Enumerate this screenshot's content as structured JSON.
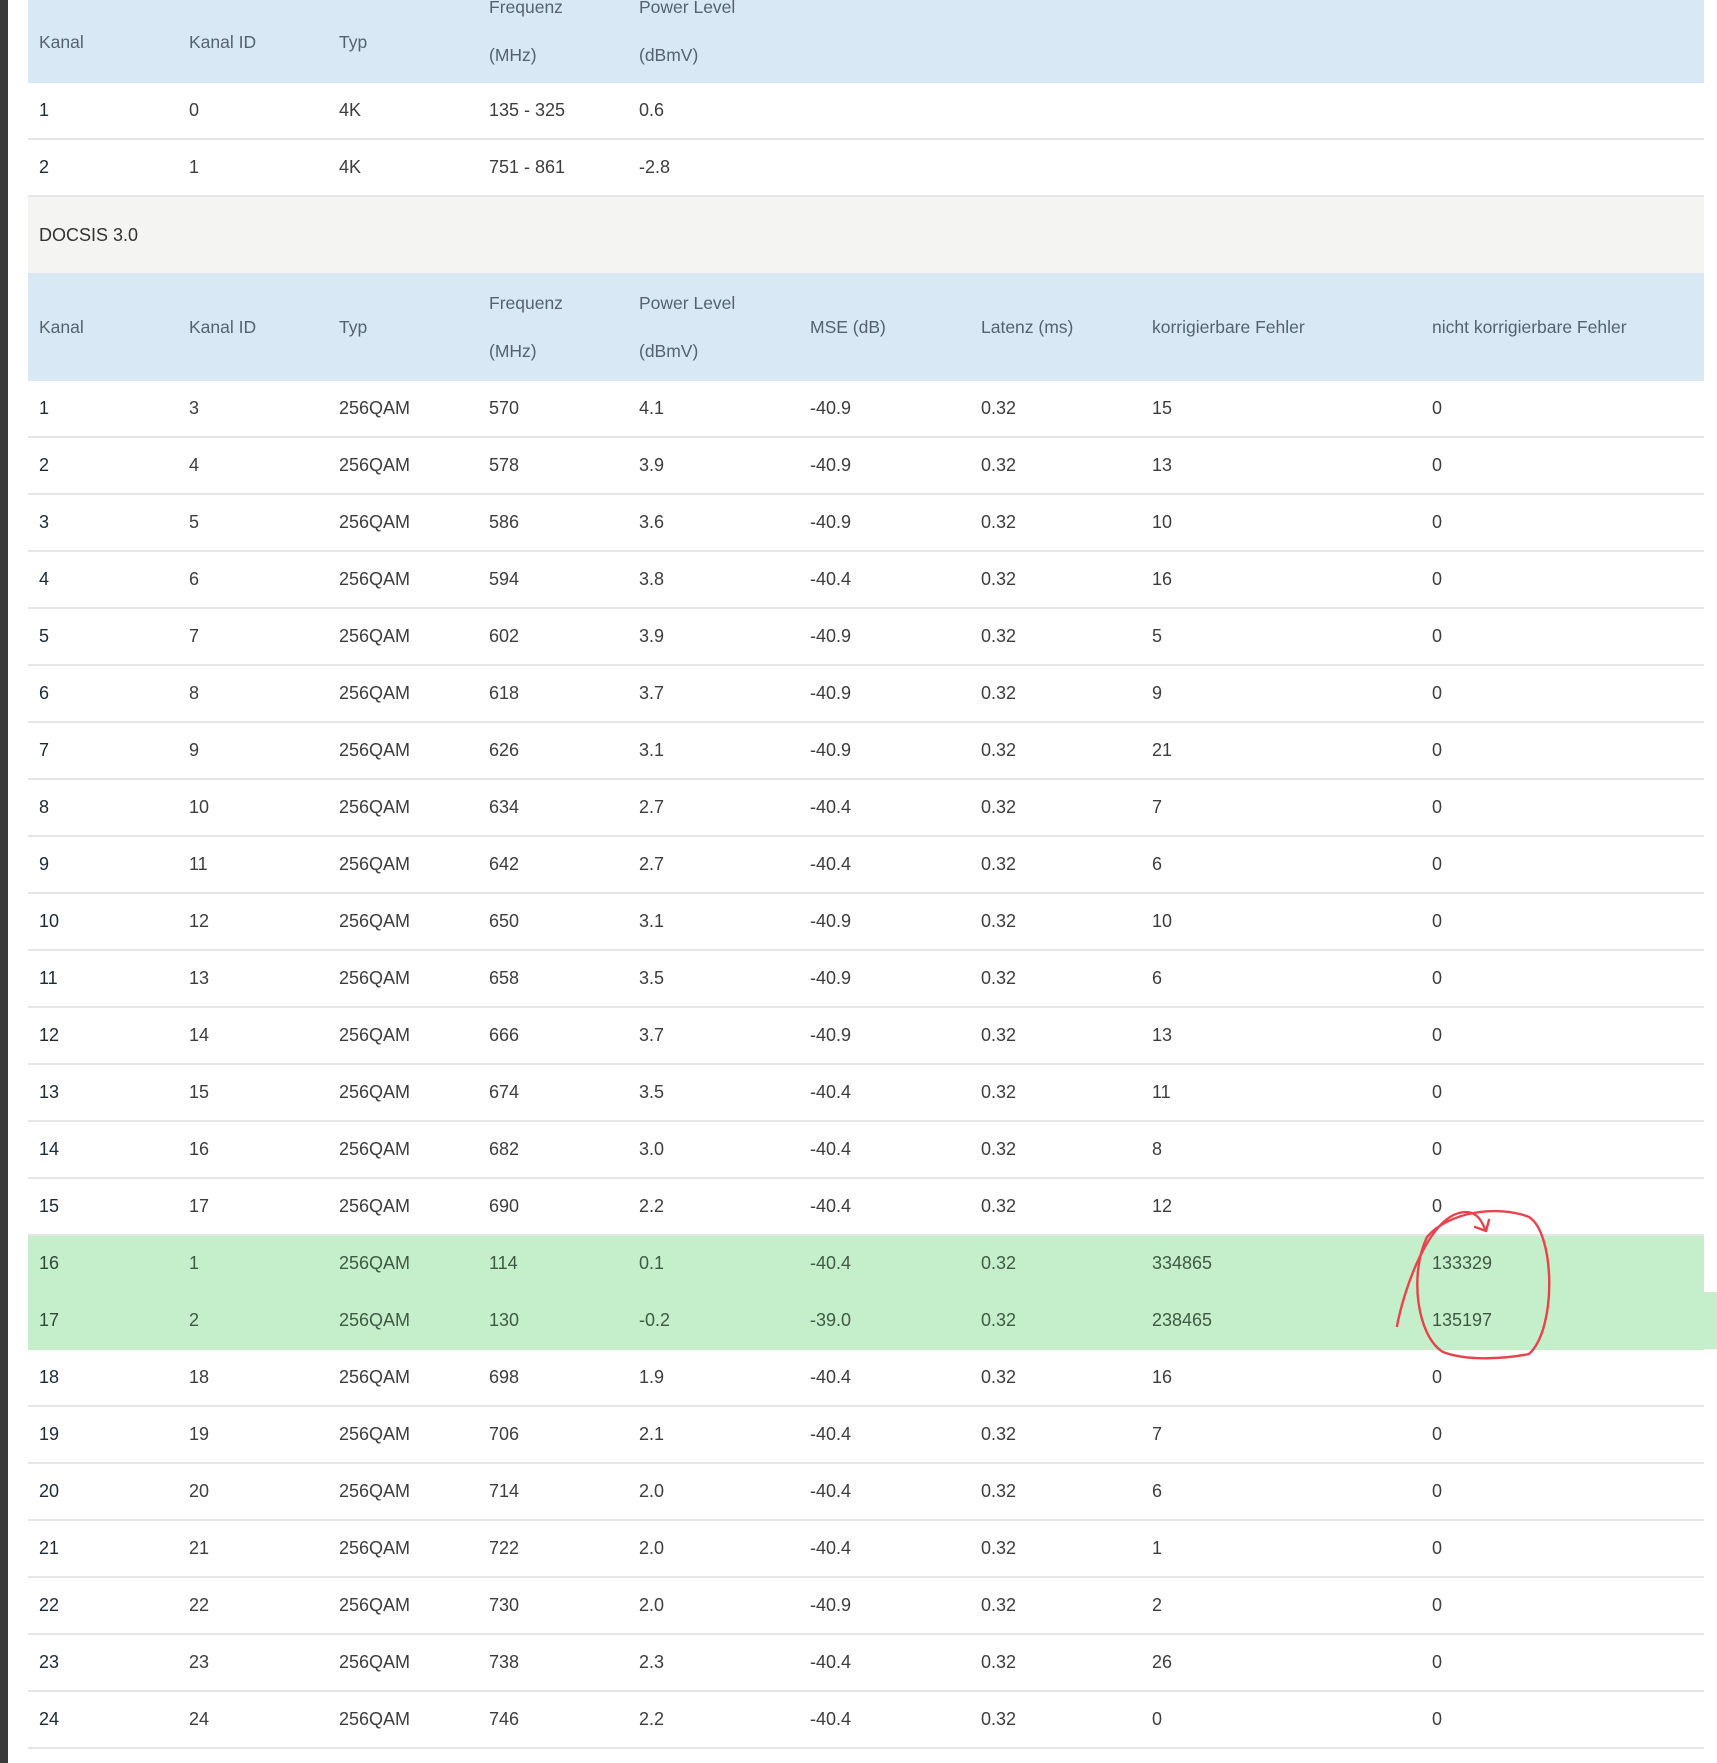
{
  "upstream_table": {
    "headers": {
      "kanal": "Kanal",
      "kanal_id": "Kanal ID",
      "typ": "Typ",
      "freq_top": "Frequenz",
      "freq_bottom": "(MHz)",
      "power_top": "Power Level",
      "power_bottom": "(dBmV)"
    },
    "rows": [
      {
        "kanal": "1",
        "kanal_id": "0",
        "typ": "4K",
        "freq": "135 - 325",
        "power": "0.6"
      },
      {
        "kanal": "2",
        "kanal_id": "1",
        "typ": "4K",
        "freq": "751 - 861",
        "power": "-2.8"
      }
    ]
  },
  "section_label": "DOCSIS 3.0",
  "docsis_table": {
    "headers": {
      "kanal": "Kanal",
      "kanal_id": "Kanal ID",
      "typ": "Typ",
      "freq_top": "Frequenz",
      "freq_bottom": "(MHz)",
      "power_top": "Power Level",
      "power_bottom": "(dBmV)",
      "mse": "MSE (dB)",
      "latency": "Latenz (ms)",
      "corr": "korrigierbare Fehler",
      "uncorr": "nicht korrigierbare Fehler"
    },
    "rows": [
      {
        "kanal": "1",
        "kanal_id": "3",
        "typ": "256QAM",
        "freq": "570",
        "power": "4.1",
        "mse": "-40.9",
        "latency": "0.32",
        "corr": "15",
        "uncorr": "0"
      },
      {
        "kanal": "2",
        "kanal_id": "4",
        "typ": "256QAM",
        "freq": "578",
        "power": "3.9",
        "mse": "-40.9",
        "latency": "0.32",
        "corr": "13",
        "uncorr": "0"
      },
      {
        "kanal": "3",
        "kanal_id": "5",
        "typ": "256QAM",
        "freq": "586",
        "power": "3.6",
        "mse": "-40.9",
        "latency": "0.32",
        "corr": "10",
        "uncorr": "0"
      },
      {
        "kanal": "4",
        "kanal_id": "6",
        "typ": "256QAM",
        "freq": "594",
        "power": "3.8",
        "mse": "-40.4",
        "latency": "0.32",
        "corr": "16",
        "uncorr": "0"
      },
      {
        "kanal": "5",
        "kanal_id": "7",
        "typ": "256QAM",
        "freq": "602",
        "power": "3.9",
        "mse": "-40.9",
        "latency": "0.32",
        "corr": "5",
        "uncorr": "0"
      },
      {
        "kanal": "6",
        "kanal_id": "8",
        "typ": "256QAM",
        "freq": "618",
        "power": "3.7",
        "mse": "-40.9",
        "latency": "0.32",
        "corr": "9",
        "uncorr": "0"
      },
      {
        "kanal": "7",
        "kanal_id": "9",
        "typ": "256QAM",
        "freq": "626",
        "power": "3.1",
        "mse": "-40.9",
        "latency": "0.32",
        "corr": "21",
        "uncorr": "0"
      },
      {
        "kanal": "8",
        "kanal_id": "10",
        "typ": "256QAM",
        "freq": "634",
        "power": "2.7",
        "mse": "-40.4",
        "latency": "0.32",
        "corr": "7",
        "uncorr": "0"
      },
      {
        "kanal": "9",
        "kanal_id": "11",
        "typ": "256QAM",
        "freq": "642",
        "power": "2.7",
        "mse": "-40.4",
        "latency": "0.32",
        "corr": "6",
        "uncorr": "0"
      },
      {
        "kanal": "10",
        "kanal_id": "12",
        "typ": "256QAM",
        "freq": "650",
        "power": "3.1",
        "mse": "-40.9",
        "latency": "0.32",
        "corr": "10",
        "uncorr": "0"
      },
      {
        "kanal": "11",
        "kanal_id": "13",
        "typ": "256QAM",
        "freq": "658",
        "power": "3.5",
        "mse": "-40.9",
        "latency": "0.32",
        "corr": "6",
        "uncorr": "0"
      },
      {
        "kanal": "12",
        "kanal_id": "14",
        "typ": "256QAM",
        "freq": "666",
        "power": "3.7",
        "mse": "-40.9",
        "latency": "0.32",
        "corr": "13",
        "uncorr": "0"
      },
      {
        "kanal": "13",
        "kanal_id": "15",
        "typ": "256QAM",
        "freq": "674",
        "power": "3.5",
        "mse": "-40.4",
        "latency": "0.32",
        "corr": "11",
        "uncorr": "0"
      },
      {
        "kanal": "14",
        "kanal_id": "16",
        "typ": "256QAM",
        "freq": "682",
        "power": "3.0",
        "mse": "-40.4",
        "latency": "0.32",
        "corr": "8",
        "uncorr": "0"
      },
      {
        "kanal": "15",
        "kanal_id": "17",
        "typ": "256QAM",
        "freq": "690",
        "power": "2.2",
        "mse": "-40.4",
        "latency": "0.32",
        "corr": "12",
        "uncorr": "0"
      },
      {
        "kanal": "16",
        "kanal_id": "1",
        "typ": "256QAM",
        "freq": "114",
        "power": "0.1",
        "mse": "-40.4",
        "latency": "0.32",
        "corr": "334865",
        "uncorr": "133329",
        "highlight": true
      },
      {
        "kanal": "17",
        "kanal_id": "2",
        "typ": "256QAM",
        "freq": "130",
        "power": "-0.2",
        "mse": "-39.0",
        "latency": "0.32",
        "corr": "238465",
        "uncorr": "135197",
        "highlight": true
      },
      {
        "kanal": "18",
        "kanal_id": "18",
        "typ": "256QAM",
        "freq": "698",
        "power": "1.9",
        "mse": "-40.4",
        "latency": "0.32",
        "corr": "16",
        "uncorr": "0"
      },
      {
        "kanal": "19",
        "kanal_id": "19",
        "typ": "256QAM",
        "freq": "706",
        "power": "2.1",
        "mse": "-40.4",
        "latency": "0.32",
        "corr": "7",
        "uncorr": "0"
      },
      {
        "kanal": "20",
        "kanal_id": "20",
        "typ": "256QAM",
        "freq": "714",
        "power": "2.0",
        "mse": "-40.4",
        "latency": "0.32",
        "corr": "6",
        "uncorr": "0"
      },
      {
        "kanal": "21",
        "kanal_id": "21",
        "typ": "256QAM",
        "freq": "722",
        "power": "2.0",
        "mse": "-40.4",
        "latency": "0.32",
        "corr": "1",
        "uncorr": "0"
      },
      {
        "kanal": "22",
        "kanal_id": "22",
        "typ": "256QAM",
        "freq": "730",
        "power": "2.0",
        "mse": "-40.9",
        "latency": "0.32",
        "corr": "2",
        "uncorr": "0"
      },
      {
        "kanal": "23",
        "kanal_id": "23",
        "typ": "256QAM",
        "freq": "738",
        "power": "2.3",
        "mse": "-40.4",
        "latency": "0.32",
        "corr": "26",
        "uncorr": "0"
      },
      {
        "kanal": "24",
        "kanal_id": "24",
        "typ": "256QAM",
        "freq": "746",
        "power": "2.2",
        "mse": "-40.4",
        "latency": "0.32",
        "corr": "0",
        "uncorr": "0"
      }
    ]
  },
  "colors": {
    "header_bg": "#d9e8f5",
    "section_bg": "#f4f4f2",
    "highlight_bg": "#c5efcb",
    "annotation_stroke": "#e8434c",
    "row_divider": "#e4e6e8"
  }
}
